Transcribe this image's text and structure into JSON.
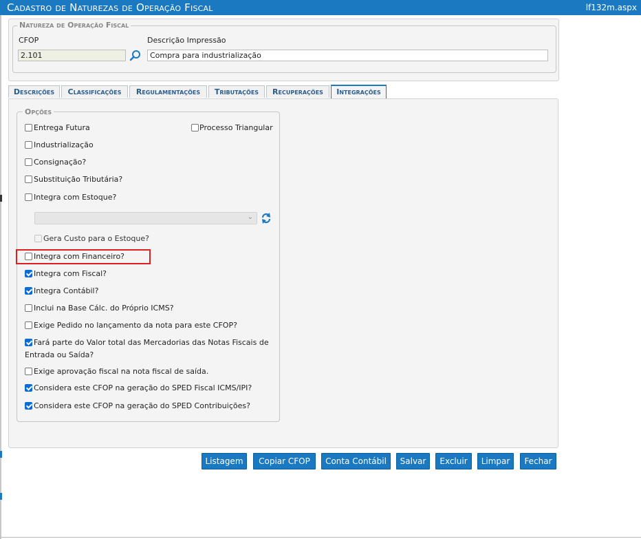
{
  "window": {
    "title": "Cadastro de Naturezas de Operação Fiscal",
    "file": "lf132m.aspx"
  },
  "natureza": {
    "legend": "Natureza de Operação Fiscal",
    "cfop_label": "CFOP",
    "cfop_value": "2.101",
    "descricao_label": "Descrição Impressão",
    "descricao_value": "Compra para industrialização"
  },
  "tabs": [
    {
      "label": "Descrições",
      "active": false
    },
    {
      "label": "Classificações",
      "active": false
    },
    {
      "label": "Regulamentações",
      "active": false
    },
    {
      "label": "Tributações",
      "active": false
    },
    {
      "label": "Recuperações",
      "active": false
    },
    {
      "label": "Integrações",
      "active": true
    }
  ],
  "opcoes": {
    "legend": "Opções",
    "entrega_futura": {
      "label": "Entrega Futura",
      "checked": false
    },
    "processo_triangular": {
      "label": "Processo Triangular",
      "checked": false
    },
    "industrializacao": {
      "label": "Industrialização",
      "checked": false
    },
    "consignacao": {
      "label": "Consignação?",
      "checked": false
    },
    "substituicao": {
      "label": "Substituição Tributária?",
      "checked": false
    },
    "integra_estoque": {
      "label": "Integra com Estoque?",
      "checked": false
    },
    "estoque_select": {
      "value": ""
    },
    "gera_custo": {
      "label": "Gera Custo para o Estoque?",
      "checked": false,
      "disabled": true
    },
    "integra_financeiro": {
      "label": "Integra com Financeiro?",
      "checked": false
    },
    "integra_fiscal": {
      "label": "Integra com Fiscal?",
      "checked": true
    },
    "integra_contabil": {
      "label": "Integra Contábil?",
      "checked": true
    },
    "inclui_base": {
      "label": "Inclui na Base Cálc. do Próprio ICMS?",
      "checked": false
    },
    "exige_pedido": {
      "label": "Exige Pedido no lançamento da nota para este CFOP?",
      "checked": false
    },
    "fara_parte": {
      "label_line1": "Fará parte do Valor total das Mercadorias das Notas Fiscais de",
      "label_line2": "Entrada ou Saída?",
      "checked": true
    },
    "exige_aprovacao": {
      "label": "Exige aprovação fiscal na nota fiscal de saída.",
      "checked": false
    },
    "sped_icms": {
      "label": "Considera este CFOP na geração do SPED Fiscal ICMS/IPI?",
      "checked": true
    },
    "sped_contrib": {
      "label": "Considera este CFOP na geração do SPED Contribuições?",
      "checked": true
    }
  },
  "buttons": {
    "listagem": "Listagem",
    "copiar": "Copiar CFOP",
    "conta": "Conta Contábil",
    "salvar": "Salvar",
    "excluir": "Excluir",
    "limpar": "Limpar",
    "fechar": "Fechar"
  },
  "colors": {
    "accent": "#1b79c2",
    "highlight": "#e01e1e",
    "checkbox_checked": "#0a6bd6"
  }
}
